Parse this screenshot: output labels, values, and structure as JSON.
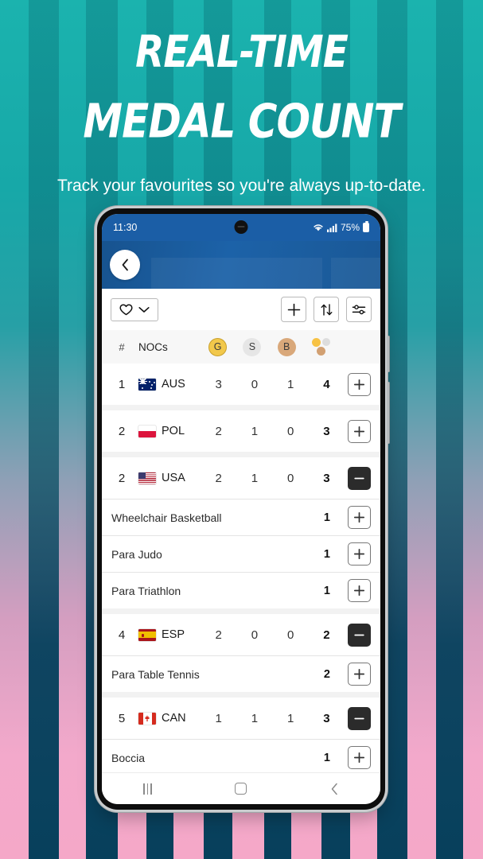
{
  "promo": {
    "headline_line1": "REAL-TIME",
    "headline_line2": "MEDAL COUNT",
    "subtitle": "Track your favourites so you're always up-to-date.",
    "bg_teal": "#17A8A8",
    "bg_pink": "#F5A8C8",
    "bg_navy": "#07405C"
  },
  "status_bar": {
    "time": "11:30",
    "battery_percent": "75%",
    "wifi_icon": "wifi-icon",
    "signal_icon": "cellular-signal-icon",
    "battery_icon": "battery-icon"
  },
  "app_header": {
    "back_icon": "chevron-left-icon"
  },
  "toolbar": {
    "favourites_icon": "heart-outline-icon",
    "favourites_chevron": "chevron-down-icon",
    "add_icon": "plus-icon",
    "sort_icon": "sort-arrows-icon",
    "filter_icon": "sliders-icon"
  },
  "table": {
    "header": {
      "rank_label": "#",
      "noc_label": "NOCs",
      "gold_label": "G",
      "silver_label": "S",
      "bronze_label": "B",
      "total_icon": "total-medals-icon"
    },
    "colors": {
      "gold": "#F2C84B",
      "silver": "#E6E6E6",
      "bronze": "#D9A87A"
    },
    "rows": [
      {
        "rank": "1",
        "code": "AUS",
        "flag": "flag-aus",
        "gold": "3",
        "silver": "0",
        "bronze": "1",
        "total": "4",
        "action": "plus",
        "expanded": false,
        "sports": []
      },
      {
        "rank": "2",
        "code": "POL",
        "flag": "flag-pol",
        "gold": "2",
        "silver": "1",
        "bronze": "0",
        "total": "3",
        "action": "plus",
        "expanded": false,
        "sports": []
      },
      {
        "rank": "2",
        "code": "USA",
        "flag": "flag-usa",
        "gold": "2",
        "silver": "1",
        "bronze": "0",
        "total": "3",
        "action": "minus",
        "expanded": true,
        "sports": [
          {
            "name": "Wheelchair Basketball",
            "count": "1"
          },
          {
            "name": "Para Judo",
            "count": "1"
          },
          {
            "name": "Para Triathlon",
            "count": "1"
          }
        ]
      },
      {
        "rank": "4",
        "code": "ESP",
        "flag": "flag-esp",
        "gold": "2",
        "silver": "0",
        "bronze": "0",
        "total": "2",
        "action": "minus",
        "expanded": true,
        "sports": [
          {
            "name": "Para Table Tennis",
            "count": "2"
          }
        ]
      },
      {
        "rank": "5",
        "code": "CAN",
        "flag": "flag-can",
        "gold": "1",
        "silver": "1",
        "bronze": "1",
        "total": "3",
        "action": "minus",
        "expanded": true,
        "sports": [
          {
            "name": "Boccia",
            "count": "1"
          }
        ]
      }
    ]
  },
  "nav_bar": {
    "recents_icon": "recents-icon",
    "home_icon": "home-icon",
    "back_icon": "back-icon"
  }
}
